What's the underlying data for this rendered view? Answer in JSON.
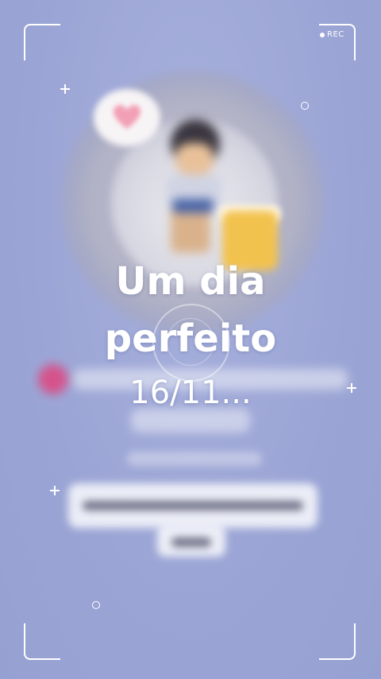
{
  "recorder": {
    "rec_label": "REC"
  },
  "overlay": {
    "title_line_1": "Um dia",
    "title_line_2": "perfeito",
    "date_text": "16/11..."
  },
  "colors": {
    "background": "#9ea8d6",
    "accent_pink": "#e0457f",
    "text": "#ffffff"
  },
  "icons": {
    "heart": "heart-icon",
    "plus": "plus-icon",
    "ring": "ring-icon",
    "rec_dot": "rec-dot-icon"
  }
}
